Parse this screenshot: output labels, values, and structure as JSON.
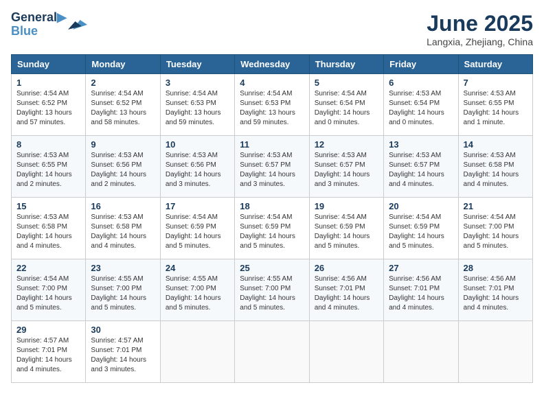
{
  "header": {
    "logo_line1": "General",
    "logo_line2": "Blue",
    "month_title": "June 2025",
    "location": "Langxia, Zhejiang, China"
  },
  "weekdays": [
    "Sunday",
    "Monday",
    "Tuesday",
    "Wednesday",
    "Thursday",
    "Friday",
    "Saturday"
  ],
  "weeks": [
    [
      {
        "day": "1",
        "sunrise": "Sunrise: 4:54 AM",
        "sunset": "Sunset: 6:52 PM",
        "daylight": "Daylight: 13 hours and 57 minutes."
      },
      {
        "day": "2",
        "sunrise": "Sunrise: 4:54 AM",
        "sunset": "Sunset: 6:52 PM",
        "daylight": "Daylight: 13 hours and 58 minutes."
      },
      {
        "day": "3",
        "sunrise": "Sunrise: 4:54 AM",
        "sunset": "Sunset: 6:53 PM",
        "daylight": "Daylight: 13 hours and 59 minutes."
      },
      {
        "day": "4",
        "sunrise": "Sunrise: 4:54 AM",
        "sunset": "Sunset: 6:53 PM",
        "daylight": "Daylight: 13 hours and 59 minutes."
      },
      {
        "day": "5",
        "sunrise": "Sunrise: 4:54 AM",
        "sunset": "Sunset: 6:54 PM",
        "daylight": "Daylight: 14 hours and 0 minutes."
      },
      {
        "day": "6",
        "sunrise": "Sunrise: 4:53 AM",
        "sunset": "Sunset: 6:54 PM",
        "daylight": "Daylight: 14 hours and 0 minutes."
      },
      {
        "day": "7",
        "sunrise": "Sunrise: 4:53 AM",
        "sunset": "Sunset: 6:55 PM",
        "daylight": "Daylight: 14 hours and 1 minute."
      }
    ],
    [
      {
        "day": "8",
        "sunrise": "Sunrise: 4:53 AM",
        "sunset": "Sunset: 6:55 PM",
        "daylight": "Daylight: 14 hours and 2 minutes."
      },
      {
        "day": "9",
        "sunrise": "Sunrise: 4:53 AM",
        "sunset": "Sunset: 6:56 PM",
        "daylight": "Daylight: 14 hours and 2 minutes."
      },
      {
        "day": "10",
        "sunrise": "Sunrise: 4:53 AM",
        "sunset": "Sunset: 6:56 PM",
        "daylight": "Daylight: 14 hours and 3 minutes."
      },
      {
        "day": "11",
        "sunrise": "Sunrise: 4:53 AM",
        "sunset": "Sunset: 6:57 PM",
        "daylight": "Daylight: 14 hours and 3 minutes."
      },
      {
        "day": "12",
        "sunrise": "Sunrise: 4:53 AM",
        "sunset": "Sunset: 6:57 PM",
        "daylight": "Daylight: 14 hours and 3 minutes."
      },
      {
        "day": "13",
        "sunrise": "Sunrise: 4:53 AM",
        "sunset": "Sunset: 6:57 PM",
        "daylight": "Daylight: 14 hours and 4 minutes."
      },
      {
        "day": "14",
        "sunrise": "Sunrise: 4:53 AM",
        "sunset": "Sunset: 6:58 PM",
        "daylight": "Daylight: 14 hours and 4 minutes."
      }
    ],
    [
      {
        "day": "15",
        "sunrise": "Sunrise: 4:53 AM",
        "sunset": "Sunset: 6:58 PM",
        "daylight": "Daylight: 14 hours and 4 minutes."
      },
      {
        "day": "16",
        "sunrise": "Sunrise: 4:53 AM",
        "sunset": "Sunset: 6:58 PM",
        "daylight": "Daylight: 14 hours and 4 minutes."
      },
      {
        "day": "17",
        "sunrise": "Sunrise: 4:54 AM",
        "sunset": "Sunset: 6:59 PM",
        "daylight": "Daylight: 14 hours and 5 minutes."
      },
      {
        "day": "18",
        "sunrise": "Sunrise: 4:54 AM",
        "sunset": "Sunset: 6:59 PM",
        "daylight": "Daylight: 14 hours and 5 minutes."
      },
      {
        "day": "19",
        "sunrise": "Sunrise: 4:54 AM",
        "sunset": "Sunset: 6:59 PM",
        "daylight": "Daylight: 14 hours and 5 minutes."
      },
      {
        "day": "20",
        "sunrise": "Sunrise: 4:54 AM",
        "sunset": "Sunset: 6:59 PM",
        "daylight": "Daylight: 14 hours and 5 minutes."
      },
      {
        "day": "21",
        "sunrise": "Sunrise: 4:54 AM",
        "sunset": "Sunset: 7:00 PM",
        "daylight": "Daylight: 14 hours and 5 minutes."
      }
    ],
    [
      {
        "day": "22",
        "sunrise": "Sunrise: 4:54 AM",
        "sunset": "Sunset: 7:00 PM",
        "daylight": "Daylight: 14 hours and 5 minutes."
      },
      {
        "day": "23",
        "sunrise": "Sunrise: 4:55 AM",
        "sunset": "Sunset: 7:00 PM",
        "daylight": "Daylight: 14 hours and 5 minutes."
      },
      {
        "day": "24",
        "sunrise": "Sunrise: 4:55 AM",
        "sunset": "Sunset: 7:00 PM",
        "daylight": "Daylight: 14 hours and 5 minutes."
      },
      {
        "day": "25",
        "sunrise": "Sunrise: 4:55 AM",
        "sunset": "Sunset: 7:00 PM",
        "daylight": "Daylight: 14 hours and 5 minutes."
      },
      {
        "day": "26",
        "sunrise": "Sunrise: 4:56 AM",
        "sunset": "Sunset: 7:01 PM",
        "daylight": "Daylight: 14 hours and 4 minutes."
      },
      {
        "day": "27",
        "sunrise": "Sunrise: 4:56 AM",
        "sunset": "Sunset: 7:01 PM",
        "daylight": "Daylight: 14 hours and 4 minutes."
      },
      {
        "day": "28",
        "sunrise": "Sunrise: 4:56 AM",
        "sunset": "Sunset: 7:01 PM",
        "daylight": "Daylight: 14 hours and 4 minutes."
      }
    ],
    [
      {
        "day": "29",
        "sunrise": "Sunrise: 4:57 AM",
        "sunset": "Sunset: 7:01 PM",
        "daylight": "Daylight: 14 hours and 4 minutes."
      },
      {
        "day": "30",
        "sunrise": "Sunrise: 4:57 AM",
        "sunset": "Sunset: 7:01 PM",
        "daylight": "Daylight: 14 hours and 3 minutes."
      },
      null,
      null,
      null,
      null,
      null
    ]
  ]
}
